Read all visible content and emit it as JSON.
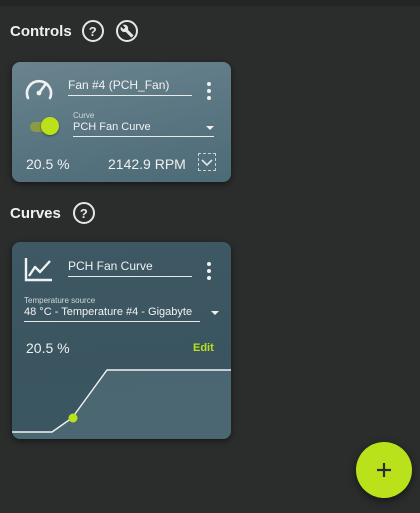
{
  "controls_section": {
    "title": "Controls"
  },
  "curves_section": {
    "title": "Curves"
  },
  "control_card": {
    "name": "Fan #4 (PCH_Fan)",
    "curve_label": "Curve",
    "curve_value": "PCH Fan Curve",
    "enabled": true,
    "percent": "20.5 %",
    "rpm": "2142.9 RPM",
    "icon": "speedometer-icon"
  },
  "curve_card": {
    "name": "PCH Fan Curve",
    "temp_source_label": "Temperature source",
    "temp_source_value": "48 °C - Temperature #4 - Gigabyte",
    "percent": "20.5 %",
    "edit_label": "Edit",
    "icon": "line-chart-icon"
  },
  "fab": {
    "label": "+"
  },
  "colors": {
    "accent": "#b9e21a",
    "background": "#2b2c2c",
    "control_card": "#5f7b86",
    "curve_card": "#3c5762"
  }
}
